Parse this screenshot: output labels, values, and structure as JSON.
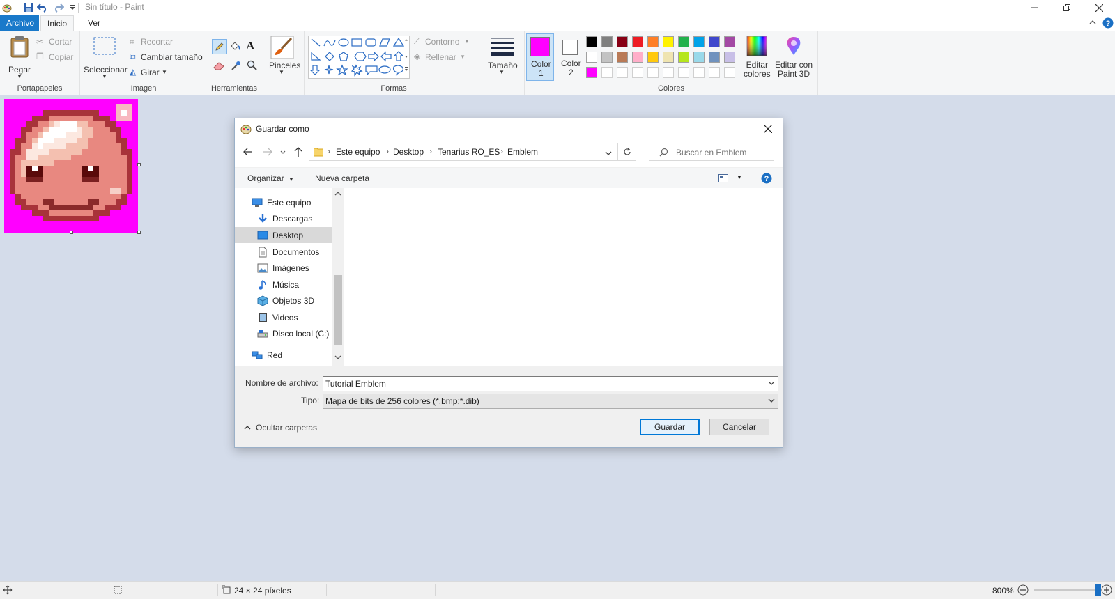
{
  "window": {
    "title": "Sin título - Paint",
    "controls": [
      "minimize",
      "restore",
      "close"
    ]
  },
  "tabs": [
    {
      "label": "Archivo",
      "active": false
    },
    {
      "label": "Inicio",
      "active": true
    },
    {
      "label": "Ver",
      "active": false
    }
  ],
  "ribbon": {
    "clipboard": {
      "group_label": "Portapapeles",
      "paste": "Pegar",
      "cut": "Cortar",
      "copy": "Copiar"
    },
    "image": {
      "group_label": "Imagen",
      "select": "Seleccionar",
      "crop": "Recortar",
      "resize": "Cambiar tamaño",
      "rotate": "Girar"
    },
    "tools": {
      "group_label": "Herramientas"
    },
    "brushes": {
      "label": "Pinceles"
    },
    "shapes": {
      "group_label": "Formas",
      "outline": "Contorno",
      "fill": "Rellenar"
    },
    "size": {
      "label": "Tamaño"
    },
    "colors": {
      "group_label": "Colores",
      "color1_label": "Color\n1",
      "color2_label": "Color\n2",
      "color1": "#ff00ff",
      "color2": "#ffffff",
      "edit_colors": "Editar\ncolores",
      "palette_row1": [
        "#000000",
        "#7f7f7f",
        "#880015",
        "#ed1c24",
        "#ff7f27",
        "#fff200",
        "#22b14c",
        "#00a2e8",
        "#3f48cc",
        "#a349a4"
      ],
      "palette_row2": [
        "#ffffff",
        "#c3c3c3",
        "#b97a57",
        "#ffaec9",
        "#ffc90e",
        "#efe4b0",
        "#b5e61d",
        "#99d9ea",
        "#7092be",
        "#c8bfe7"
      ],
      "palette_row3": [
        "#ff00ff",
        "",
        "",
        "",
        "",
        "",
        "",
        "",
        "",
        ""
      ]
    },
    "paint3d": {
      "label": "Editar con\nPaint 3D"
    }
  },
  "dialog": {
    "title": "Guardar como",
    "breadcrumb": [
      "Este equipo",
      "Desktop",
      "Tenarius RO_ES",
      "Emblem"
    ],
    "search_placeholder": "Buscar en Emblem",
    "organize": "Organizar",
    "new_folder": "Nueva carpeta",
    "nav_items": [
      {
        "label": "Este equipo",
        "icon": "computer-icon",
        "level": 0
      },
      {
        "label": "Descargas",
        "icon": "download-icon",
        "level": 1
      },
      {
        "label": "Desktop",
        "icon": "desktop-icon",
        "level": 1,
        "selected": true
      },
      {
        "label": "Documentos",
        "icon": "document-icon",
        "level": 1
      },
      {
        "label": "Imágenes",
        "icon": "pictures-icon",
        "level": 1
      },
      {
        "label": "Música",
        "icon": "music-icon",
        "level": 1
      },
      {
        "label": "Objetos 3D",
        "icon": "cube-icon",
        "level": 1
      },
      {
        "label": "Videos",
        "icon": "video-icon",
        "level": 1
      },
      {
        "label": "Disco local (C:)",
        "icon": "drive-icon",
        "level": 1
      },
      {
        "label": "Red",
        "icon": "network-icon",
        "level": 0
      }
    ],
    "filename_label": "Nombre de archivo:",
    "filename_value": "Tutorial Emblem",
    "type_label": "Tipo:",
    "type_value": "Mapa de bits de 256 colores (*.bmp;*.dib)",
    "hide_folders": "Ocultar carpetas",
    "save_button": "Guardar",
    "cancel_button": "Cancelar"
  },
  "status": {
    "image_size": "24 × 24 píxeles",
    "zoom": "800%"
  }
}
